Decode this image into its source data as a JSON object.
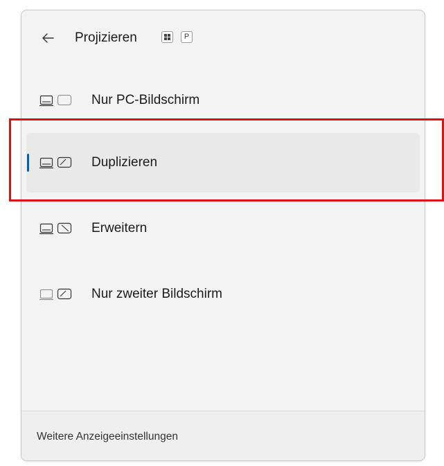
{
  "header": {
    "back_icon": "arrow-left-icon",
    "title": "Projizieren",
    "shortcut_keys": [
      "win-key-icon",
      "P"
    ]
  },
  "items": [
    {
      "label": "Nur PC-Bildschirm",
      "icon": "pc-screen-only-icon",
      "selected": false
    },
    {
      "label": "Duplizieren",
      "icon": "duplicate-icon",
      "selected": true
    },
    {
      "label": "Erweitern",
      "icon": "extend-icon",
      "selected": false
    },
    {
      "label": "Nur zweiter Bildschirm",
      "icon": "second-screen-only-icon",
      "selected": false
    }
  ],
  "footer": {
    "link_label": "Weitere Anzeigeeinstellungen"
  },
  "colors": {
    "accent": "#005fb8",
    "annotation": "#e01010",
    "panel_bg": "#f3f3f3",
    "selected_bg": "#e9e9e9"
  }
}
